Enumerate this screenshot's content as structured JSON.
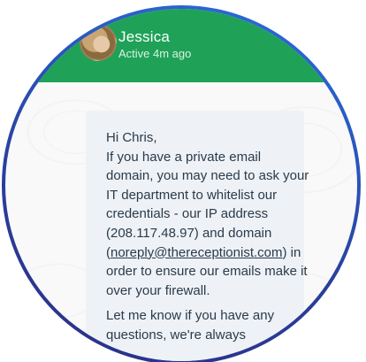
{
  "chat": {
    "contact_name": "Jessica",
    "status": "Active 4m ago"
  },
  "message": {
    "greeting": "Hi Chris,",
    "body_before_link": "If you have a private email domain, you may need to ask your IT department to whitelist our credentials - our IP address (208.117.48.97) and domain (",
    "link": "noreply@thereceptionist.com",
    "body_after_link": ") in order to ensure our emails make it over your firewall.",
    "followup": "Let me know if you have any questions, we're always"
  },
  "colors": {
    "header": "#1fa258",
    "ring": "#2a3f9c",
    "bubble": "#eef2f6"
  }
}
